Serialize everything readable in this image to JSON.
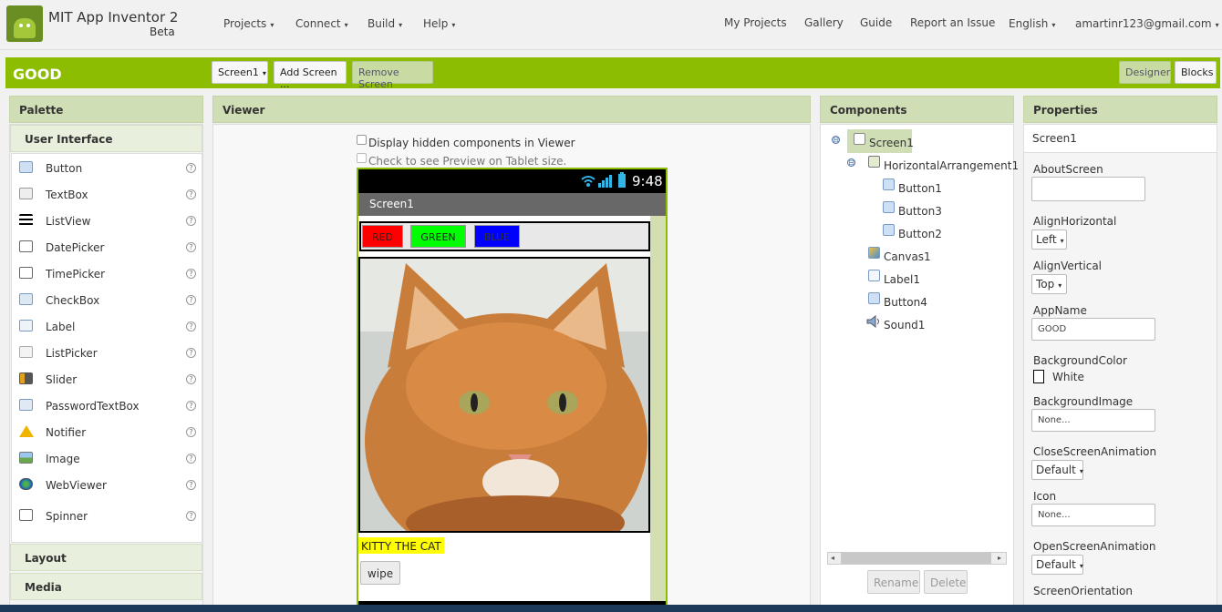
{
  "app": {
    "title": "MIT App Inventor 2",
    "subtitle": "Beta"
  },
  "nav": {
    "projects": "Projects",
    "connect": "Connect",
    "build": "Build",
    "help": "Help",
    "my_projects": "My Projects",
    "gallery": "Gallery",
    "guide": "Guide",
    "report": "Report an Issue",
    "language": "English",
    "user": "amartinr123@gmail.com"
  },
  "toolbar": {
    "project_name": "GOOD",
    "screen_select": "Screen1",
    "add_screen": "Add Screen ...",
    "remove_screen": "Remove Screen",
    "designer": "Designer",
    "blocks": "Blocks"
  },
  "palette": {
    "title": "Palette",
    "section_ui": "User Interface",
    "items": [
      "Button",
      "TextBox",
      "ListView",
      "DatePicker",
      "TimePicker",
      "CheckBox",
      "Label",
      "ListPicker",
      "Slider",
      "PasswordTextBox",
      "Notifier",
      "Image",
      "WebViewer",
      "Spinner"
    ],
    "help": "?",
    "section_layout": "Layout",
    "section_media": "Media"
  },
  "viewer": {
    "title": "Viewer",
    "hidden_components": "Display hidden components in Viewer",
    "tablet_preview": "Check to see Preview on Tablet size.",
    "time": "9:48",
    "screen_title": "Screen1",
    "btn_red": "RED",
    "btn_green": "GREEN",
    "btn_blue": "BLUE",
    "label_text": "KITTY THE CAT",
    "wipe": "wipe"
  },
  "components": {
    "title": "Components",
    "toggle": "⊟",
    "tree": [
      "Screen1",
      "HorizontalArrangement1",
      "Button1",
      "Button3",
      "Button2",
      "Canvas1",
      "Label1",
      "Button4",
      "Sound1"
    ],
    "rename": "Rename",
    "delete": "Delete"
  },
  "properties": {
    "title": "Properties",
    "screen": "Screen1",
    "about_screen": "AboutScreen",
    "align_horizontal": "AlignHorizontal",
    "align_horizontal_value": "Left",
    "align_vertical": "AlignVertical",
    "align_vertical_value": "Top",
    "app_name": "AppName",
    "app_name_value": "GOOD",
    "background_color": "BackgroundColor",
    "background_color_value": "White",
    "background_image": "BackgroundImage",
    "background_image_value": "None...",
    "close_anim": "CloseScreenAnimation",
    "close_anim_value": "Default",
    "icon": "Icon",
    "icon_value": "None...",
    "open_anim": "OpenScreenAnimation",
    "open_anim_value": "Default",
    "screen_orientation": "ScreenOrientation"
  },
  "colors": {
    "accent": "#8cbd00",
    "panel_header": "#d0deb5",
    "red": "#ff0000",
    "green": "#00ff00",
    "blue": "#0000ff",
    "label_bg": "#ffff00"
  }
}
